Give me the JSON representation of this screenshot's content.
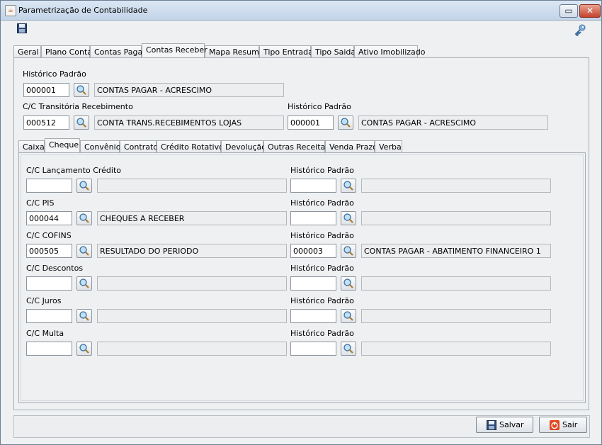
{
  "window": {
    "title": "Parametrização de Contabilidade",
    "restore_glyph": "▭",
    "close_glyph": "✕",
    "app_icon_glyph": "☕"
  },
  "toolbar": {
    "save_icon": "save-icon",
    "key_icon": "key-icon"
  },
  "main_tabs": [
    {
      "label": "Geral"
    },
    {
      "label": "Plano Conta"
    },
    {
      "label": "Contas Pagar"
    },
    {
      "label": "Contas Receber",
      "active": true
    },
    {
      "label": "Mapa Resumo"
    },
    {
      "label": "Tipo Entrada"
    },
    {
      "label": "Tipo Saida"
    },
    {
      "label": "Ativo Imobilizado"
    }
  ],
  "top_fields": {
    "historico_label": "Histórico Padrão",
    "historico_code": "000001",
    "historico_desc": "CONTAS PAGAR - ACRESCIMO",
    "transitoria_label": "C/C Transitória Recebimento",
    "transitoria_code": "000512",
    "transitoria_desc": "CONTA TRANS.RECEBIMENTOS LOJAS",
    "historico2_label": "Histórico Padrão",
    "historico2_code": "000001",
    "historico2_desc": "CONTAS PAGAR - ACRESCIMO"
  },
  "sub_tabs": [
    {
      "label": "Caixa"
    },
    {
      "label": "Cheque",
      "active": true
    },
    {
      "label": "Convênio"
    },
    {
      "label": "Contrato"
    },
    {
      "label": "Crédito Rotativo"
    },
    {
      "label": "Devolução"
    },
    {
      "label": "Outras Receitas"
    },
    {
      "label": "Venda Prazo"
    },
    {
      "label": "Verba"
    }
  ],
  "cheque_rows": [
    {
      "label": "C/C Lançamento Crédito",
      "code": "",
      "desc": "",
      "hist_label": "Histórico Padrão",
      "hist_code": "",
      "hist_desc": ""
    },
    {
      "label": "C/C PIS",
      "code": "000044",
      "desc": "CHEQUES A RECEBER",
      "hist_label": "Histórico Padrão",
      "hist_code": "",
      "hist_desc": ""
    },
    {
      "label": "C/C COFINS",
      "code": "000505",
      "desc": "RESULTADO DO PERIODO",
      "hist_label": "Histórico Padrão",
      "hist_code": "000003",
      "hist_desc": "CONTAS PAGAR - ABATIMENTO FINANCEIRO 1"
    },
    {
      "label": "C/C Descontos",
      "code": "",
      "desc": "",
      "hist_label": "Histórico Padrão",
      "hist_code": "",
      "hist_desc": ""
    },
    {
      "label": "C/C Juros",
      "code": "",
      "desc": "",
      "hist_label": "Histórico Padrão",
      "hist_code": "",
      "hist_desc": ""
    },
    {
      "label": "C/C Multa",
      "code": "",
      "desc": "",
      "hist_label": "Histórico Padrão",
      "hist_code": "",
      "hist_desc": ""
    }
  ],
  "actions": {
    "save_label": "Salvar",
    "exit_label": "Sair"
  }
}
